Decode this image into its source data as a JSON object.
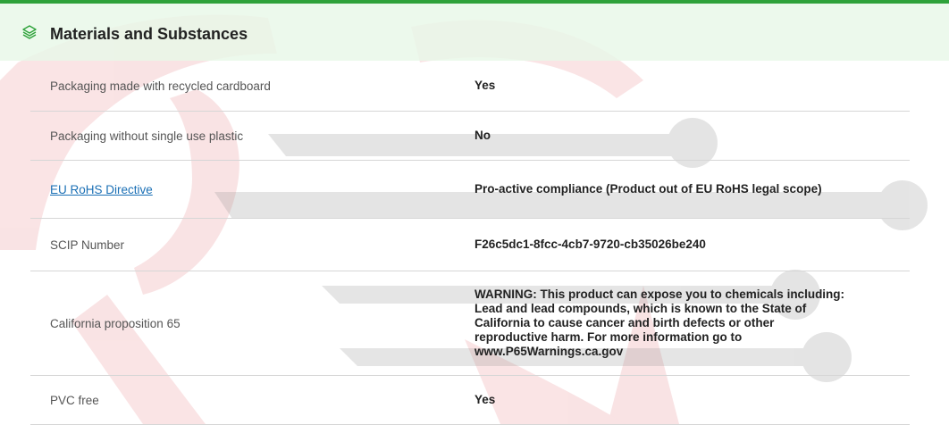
{
  "section": {
    "title": "Materials and Substances",
    "icon": "layers-icon",
    "accent_color": "#2ea23a",
    "header_bg": "#e8f8e8"
  },
  "rows": [
    {
      "label": "Packaging made with recycled cardboard",
      "value": "Yes"
    },
    {
      "label": "Packaging without single use plastic",
      "value": "No"
    },
    {
      "label": "EU RoHS Directive",
      "value": "Pro-active compliance (Product out of EU RoHS legal scope)"
    },
    {
      "label": "SCIP Number",
      "value": "F26c5dc1-8fcc-4cb7-9720-cb35026be240"
    },
    {
      "label": "California proposition 65",
      "value": "WARNING: This product can expose you to chemicals including: Lead and lead compounds, which is known to the State of California to cause cancer and birth defects or other reproductive harm. For more information go to www.P65Warnings.ca.gov"
    },
    {
      "label": "PVC free",
      "value": "Yes"
    }
  ]
}
